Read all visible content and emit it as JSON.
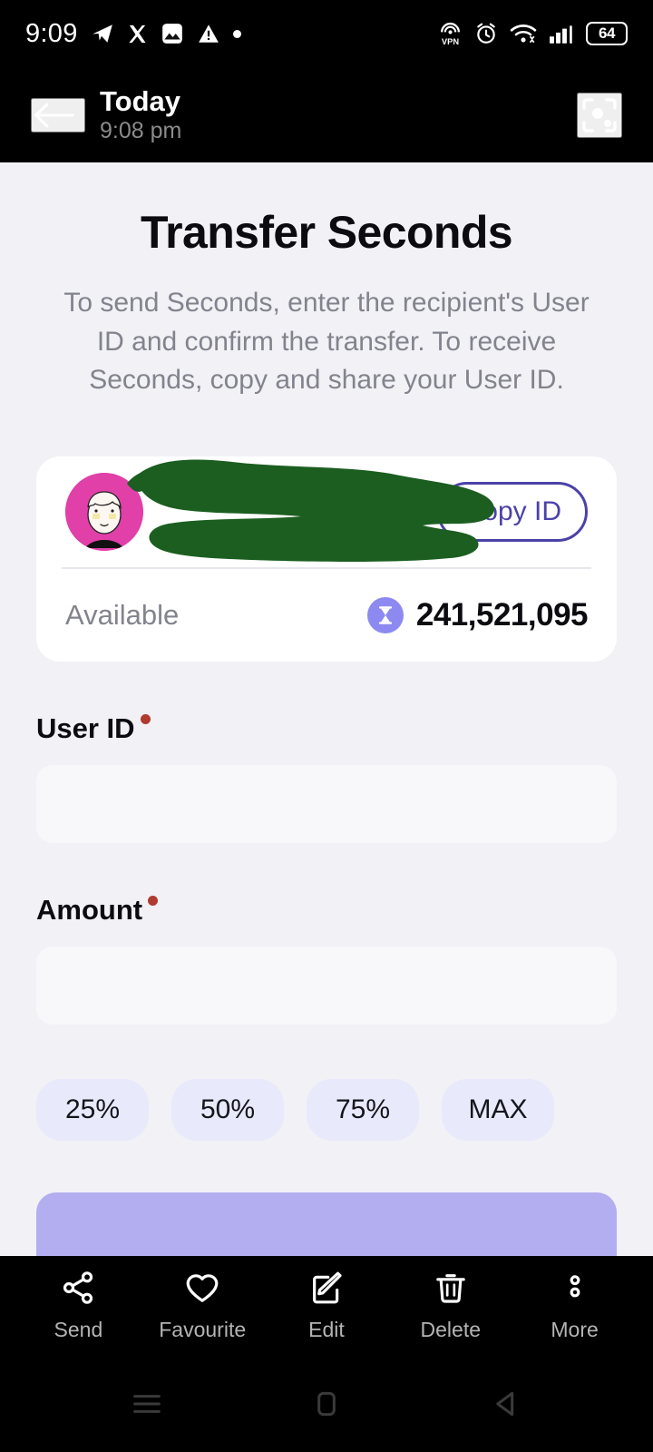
{
  "status_bar": {
    "clock": "9:09",
    "battery_level": "64",
    "left_icons": [
      "telegram-icon",
      "x-logo-icon",
      "gallery-icon",
      "warning-triangle-icon",
      "dot-indicator-icon"
    ],
    "right_icons": [
      "vpn-icon",
      "alarm-icon",
      "wifi-icon",
      "cellular-signal-icon",
      "battery-icon"
    ]
  },
  "app_bar": {
    "back_icon": "back-arrow-icon",
    "title": "Today",
    "subtitle": "9:08 pm",
    "action_icon": "lens-scan-icon"
  },
  "page": {
    "title": "Transfer Seconds",
    "description": "To send Seconds, enter the recipient's User ID and confirm the transfer. To receive Seconds, copy and share your User ID."
  },
  "profile_card": {
    "avatar": "user-avatar",
    "username": "",
    "username_redacted": true,
    "copy_button_label": "Copy ID",
    "available_label": "Available",
    "balance": "241,521,095",
    "balance_icon": "hourglass-coin-icon"
  },
  "form": {
    "user_id": {
      "label": "User ID",
      "required": true,
      "value": "",
      "placeholder": ""
    },
    "amount": {
      "label": "Amount",
      "required": true,
      "value": "",
      "placeholder": ""
    },
    "quick_amounts": [
      "25%",
      "50%",
      "75%",
      "MAX"
    ],
    "submit_label": ""
  },
  "action_bar": {
    "items": [
      {
        "label": "Send",
        "icon": "share-icon"
      },
      {
        "label": "Favourite",
        "icon": "heart-icon"
      },
      {
        "label": "Edit",
        "icon": "edit-pencil-icon"
      },
      {
        "label": "Delete",
        "icon": "trash-icon"
      },
      {
        "label": "More",
        "icon": "more-vertical-icon"
      }
    ]
  },
  "nav_bar": {
    "recents_icon": "recents-icon",
    "home_icon": "home-icon",
    "back_icon": "back-triangle-icon"
  },
  "colors": {
    "background": "#F1F1F6",
    "card": "#FFFFFF",
    "accent_purple": "#4B42A8",
    "coin_purple": "#8C8AF0",
    "submit_purple": "#B3AEF0",
    "chip_bg": "#E8E9FB",
    "redaction_green": "#1B5E20",
    "avatar_pink": "#E040A8",
    "required_red": "#B03A2E",
    "muted_text": "#83838E"
  }
}
